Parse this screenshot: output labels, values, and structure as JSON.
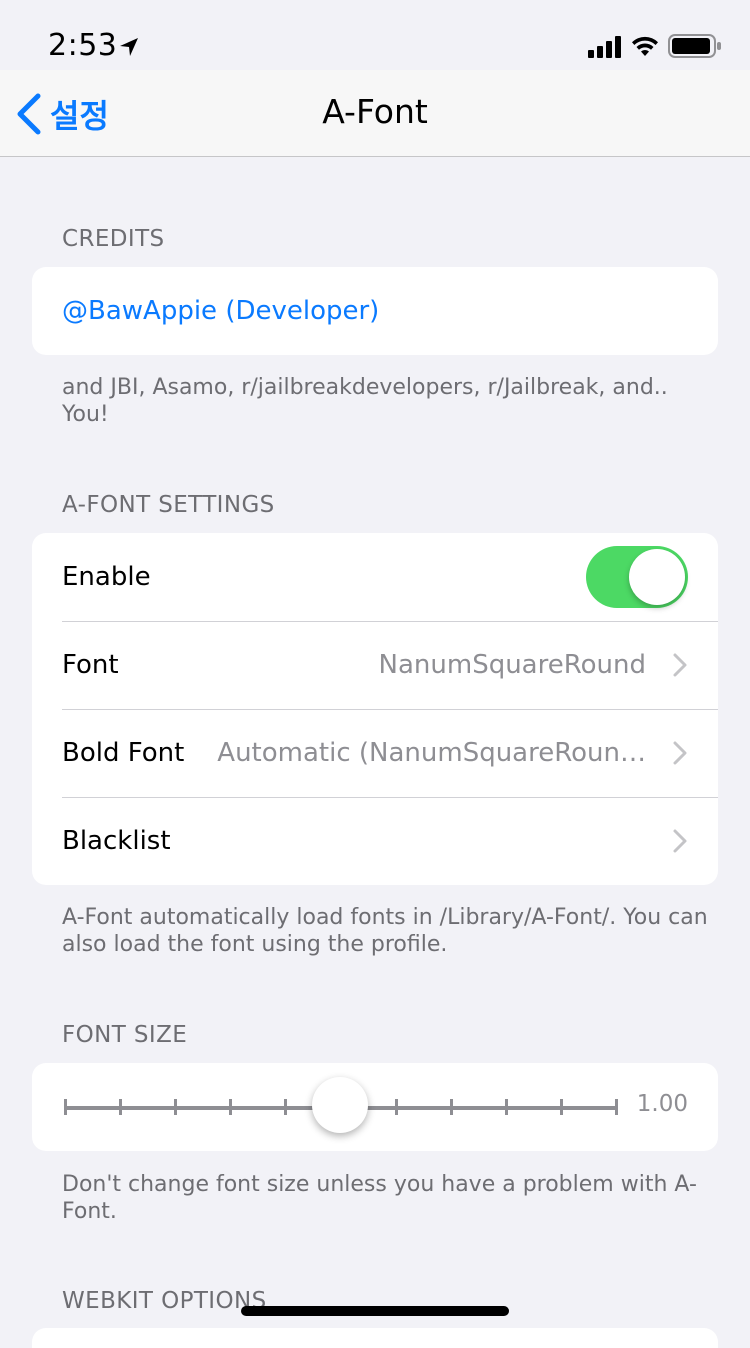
{
  "status_bar": {
    "time": "2:53"
  },
  "nav": {
    "back_label": "설정",
    "title": "A-Font"
  },
  "credits": {
    "header": "CREDITS",
    "link": "@BawAppie (Developer)",
    "footer": "and JBI, Asamo, r/jailbreakdevelopers, r/Jailbreak, and.. You!"
  },
  "settings": {
    "header": "A-FONT SETTINGS",
    "enable_label": "Enable",
    "enable_on": true,
    "font_label": "Font",
    "font_value": "NanumSquareRound",
    "bold_label": "Bold Font",
    "bold_value": "Automatic (NanumSquareRoun…",
    "blacklist_label": "Blacklist",
    "footer": "A-Font automatically load fonts in /Library/A-Font/. You can also load the font using the profile."
  },
  "font_size": {
    "header": "FONT SIZE",
    "value": "1.00",
    "footer": "Don't change font size unless you have a problem with A-Font."
  },
  "webkit": {
    "header": "WEBKIT OPTIONS"
  },
  "colors": {
    "accent": "#0a7aff",
    "toggle_on": "#4cd964",
    "background": "#f2f2f7"
  }
}
